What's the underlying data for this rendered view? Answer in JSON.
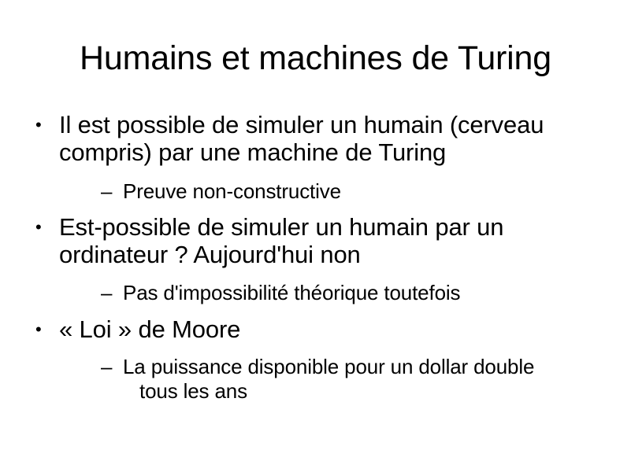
{
  "slide": {
    "title": "Humains et machines de Turing",
    "bullet_glyph": "•",
    "sub_glyph": "–",
    "items": [
      {
        "line1": "Il est possible de simuler un humain (cerveau",
        "line2": "compris) par une machine de Turing",
        "sub": {
          "line1": "Preuve non-constructive",
          "line2": ""
        }
      },
      {
        "line1": "Est-possible de simuler un humain par un",
        "line2": "ordinateur ? Aujourd'hui non",
        "sub": {
          "line1": "Pas d'impossibilité théorique toutefois",
          "line2": ""
        }
      },
      {
        "line1": "« Loi » de Moore",
        "line2": "",
        "sub": {
          "line1": "La puissance disponible pour un dollar double",
          "line2": "tous les ans"
        }
      }
    ]
  }
}
